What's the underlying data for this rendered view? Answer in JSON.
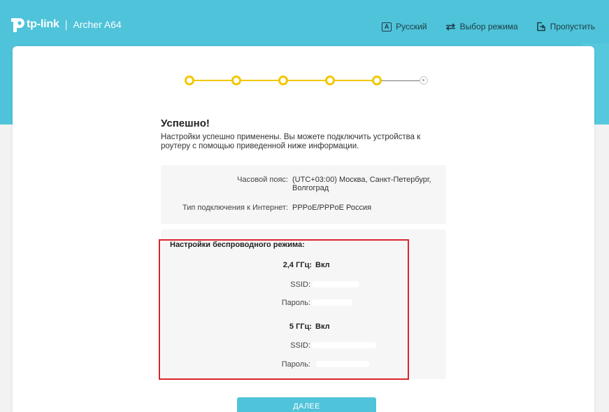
{
  "header": {
    "brand": "tp-link",
    "separator": "|",
    "model": "Archer A64",
    "actions": [
      {
        "label": "Русский",
        "icon": "language-icon",
        "glyph": "A"
      },
      {
        "label": "Выбор режима",
        "icon": "swap-icon",
        "glyph": "⇆"
      },
      {
        "label": "Пропустить",
        "icon": "skip-icon",
        "glyph": "→"
      }
    ]
  },
  "stepper": {
    "total": 6,
    "completed": 5,
    "active_color": "#f2c700"
  },
  "main": {
    "title": "Успешно!",
    "description": "Настройки успешно применены. Вы можете подключить устройства к роутеру с помощью приведенной ниже информации.",
    "summary": {
      "timezone_label": "Часовой пояс:",
      "timezone_value": "(UTC+03:00) Москва, Санкт-Петербург, Волгоград",
      "connection_label": "Тип подключения к Интернет:",
      "connection_value": "PPPoE/PPPoE Россия"
    },
    "wireless": {
      "heading": "Настройки беспроводного режима:",
      "band24_label": "2,4 ГГц:",
      "band24_value": "Вкл",
      "ssid_label_24": "SSID:",
      "password_label_24": "Пароль:",
      "band5_label": "5 ГГц:",
      "band5_value": "Вкл",
      "ssid_label_5": "SSID:",
      "password_label_5": "Пароль:"
    },
    "next_button": "ДАЛЕЕ"
  },
  "colors": {
    "brand": "#4fc3d9",
    "highlight": "#d9262c",
    "step": "#f2c700"
  }
}
